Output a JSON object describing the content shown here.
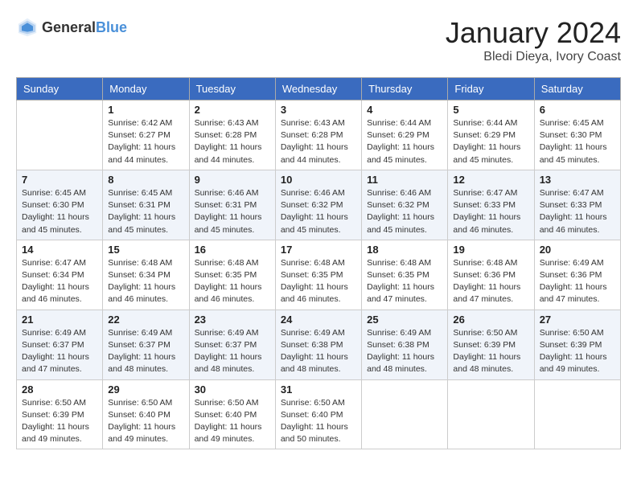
{
  "header": {
    "logo_general": "General",
    "logo_blue": "Blue",
    "month_year": "January 2024",
    "location": "Bledi Dieya, Ivory Coast"
  },
  "days_of_week": [
    "Sunday",
    "Monday",
    "Tuesday",
    "Wednesday",
    "Thursday",
    "Friday",
    "Saturday"
  ],
  "weeks": [
    [
      {
        "day": "",
        "info": ""
      },
      {
        "day": "1",
        "info": "Sunrise: 6:42 AM\nSunset: 6:27 PM\nDaylight: 11 hours\nand 44 minutes."
      },
      {
        "day": "2",
        "info": "Sunrise: 6:43 AM\nSunset: 6:28 PM\nDaylight: 11 hours\nand 44 minutes."
      },
      {
        "day": "3",
        "info": "Sunrise: 6:43 AM\nSunset: 6:28 PM\nDaylight: 11 hours\nand 44 minutes."
      },
      {
        "day": "4",
        "info": "Sunrise: 6:44 AM\nSunset: 6:29 PM\nDaylight: 11 hours\nand 45 minutes."
      },
      {
        "day": "5",
        "info": "Sunrise: 6:44 AM\nSunset: 6:29 PM\nDaylight: 11 hours\nand 45 minutes."
      },
      {
        "day": "6",
        "info": "Sunrise: 6:45 AM\nSunset: 6:30 PM\nDaylight: 11 hours\nand 45 minutes."
      }
    ],
    [
      {
        "day": "7",
        "info": "Sunrise: 6:45 AM\nSunset: 6:30 PM\nDaylight: 11 hours\nand 45 minutes."
      },
      {
        "day": "8",
        "info": "Sunrise: 6:45 AM\nSunset: 6:31 PM\nDaylight: 11 hours\nand 45 minutes."
      },
      {
        "day": "9",
        "info": "Sunrise: 6:46 AM\nSunset: 6:31 PM\nDaylight: 11 hours\nand 45 minutes."
      },
      {
        "day": "10",
        "info": "Sunrise: 6:46 AM\nSunset: 6:32 PM\nDaylight: 11 hours\nand 45 minutes."
      },
      {
        "day": "11",
        "info": "Sunrise: 6:46 AM\nSunset: 6:32 PM\nDaylight: 11 hours\nand 45 minutes."
      },
      {
        "day": "12",
        "info": "Sunrise: 6:47 AM\nSunset: 6:33 PM\nDaylight: 11 hours\nand 46 minutes."
      },
      {
        "day": "13",
        "info": "Sunrise: 6:47 AM\nSunset: 6:33 PM\nDaylight: 11 hours\nand 46 minutes."
      }
    ],
    [
      {
        "day": "14",
        "info": "Sunrise: 6:47 AM\nSunset: 6:34 PM\nDaylight: 11 hours\nand 46 minutes."
      },
      {
        "day": "15",
        "info": "Sunrise: 6:48 AM\nSunset: 6:34 PM\nDaylight: 11 hours\nand 46 minutes."
      },
      {
        "day": "16",
        "info": "Sunrise: 6:48 AM\nSunset: 6:35 PM\nDaylight: 11 hours\nand 46 minutes."
      },
      {
        "day": "17",
        "info": "Sunrise: 6:48 AM\nSunset: 6:35 PM\nDaylight: 11 hours\nand 46 minutes."
      },
      {
        "day": "18",
        "info": "Sunrise: 6:48 AM\nSunset: 6:35 PM\nDaylight: 11 hours\nand 47 minutes."
      },
      {
        "day": "19",
        "info": "Sunrise: 6:48 AM\nSunset: 6:36 PM\nDaylight: 11 hours\nand 47 minutes."
      },
      {
        "day": "20",
        "info": "Sunrise: 6:49 AM\nSunset: 6:36 PM\nDaylight: 11 hours\nand 47 minutes."
      }
    ],
    [
      {
        "day": "21",
        "info": "Sunrise: 6:49 AM\nSunset: 6:37 PM\nDaylight: 11 hours\nand 47 minutes."
      },
      {
        "day": "22",
        "info": "Sunrise: 6:49 AM\nSunset: 6:37 PM\nDaylight: 11 hours\nand 48 minutes."
      },
      {
        "day": "23",
        "info": "Sunrise: 6:49 AM\nSunset: 6:37 PM\nDaylight: 11 hours\nand 48 minutes."
      },
      {
        "day": "24",
        "info": "Sunrise: 6:49 AM\nSunset: 6:38 PM\nDaylight: 11 hours\nand 48 minutes."
      },
      {
        "day": "25",
        "info": "Sunrise: 6:49 AM\nSunset: 6:38 PM\nDaylight: 11 hours\nand 48 minutes."
      },
      {
        "day": "26",
        "info": "Sunrise: 6:50 AM\nSunset: 6:39 PM\nDaylight: 11 hours\nand 48 minutes."
      },
      {
        "day": "27",
        "info": "Sunrise: 6:50 AM\nSunset: 6:39 PM\nDaylight: 11 hours\nand 49 minutes."
      }
    ],
    [
      {
        "day": "28",
        "info": "Sunrise: 6:50 AM\nSunset: 6:39 PM\nDaylight: 11 hours\nand 49 minutes."
      },
      {
        "day": "29",
        "info": "Sunrise: 6:50 AM\nSunset: 6:40 PM\nDaylight: 11 hours\nand 49 minutes."
      },
      {
        "day": "30",
        "info": "Sunrise: 6:50 AM\nSunset: 6:40 PM\nDaylight: 11 hours\nand 49 minutes."
      },
      {
        "day": "31",
        "info": "Sunrise: 6:50 AM\nSunset: 6:40 PM\nDaylight: 11 hours\nand 50 minutes."
      },
      {
        "day": "",
        "info": ""
      },
      {
        "day": "",
        "info": ""
      },
      {
        "day": "",
        "info": ""
      }
    ]
  ]
}
